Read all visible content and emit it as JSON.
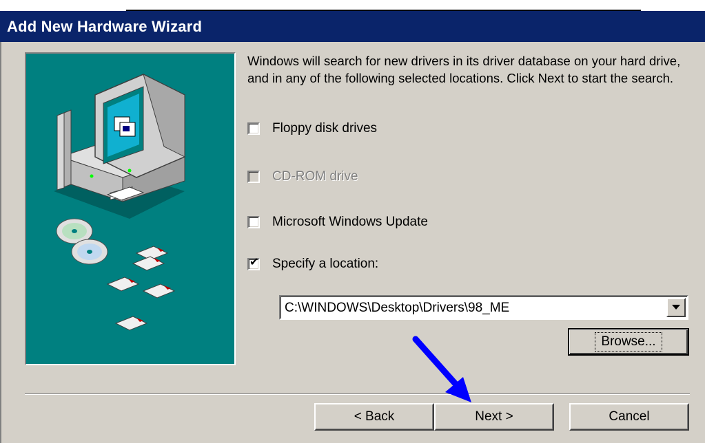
{
  "window": {
    "title": "Add New Hardware Wizard"
  },
  "description": "Windows will search for new drivers in its driver database on your hard drive, and in any of the following selected locations. Click Next to start the search.",
  "options": [
    {
      "label": "Floppy disk drives",
      "checked": false,
      "enabled": true
    },
    {
      "label": "CD-ROM drive",
      "checked": false,
      "enabled": false
    },
    {
      "label": "Microsoft Windows Update",
      "checked": false,
      "enabled": true
    },
    {
      "label": "Specify a location:",
      "checked": true,
      "enabled": true
    }
  ],
  "location": {
    "value": "C:\\WINDOWS\\Desktop\\Drivers\\98_ME"
  },
  "buttons": {
    "browse": "Browse...",
    "back": "< Back",
    "next": "Next >",
    "cancel": "Cancel"
  },
  "annotation": {
    "arrow_color": "#0000ff"
  },
  "icons": [
    "computer-illustration",
    "cd-disc-icon",
    "floppy-disk-icon",
    "dropdown-arrow-icon",
    "pointer-arrow-icon",
    "check-mark-icon"
  ],
  "colors": {
    "titlebar": "#0a246a",
    "dialog_bg": "#d4d0c8",
    "illustration_bg": "#008080"
  }
}
